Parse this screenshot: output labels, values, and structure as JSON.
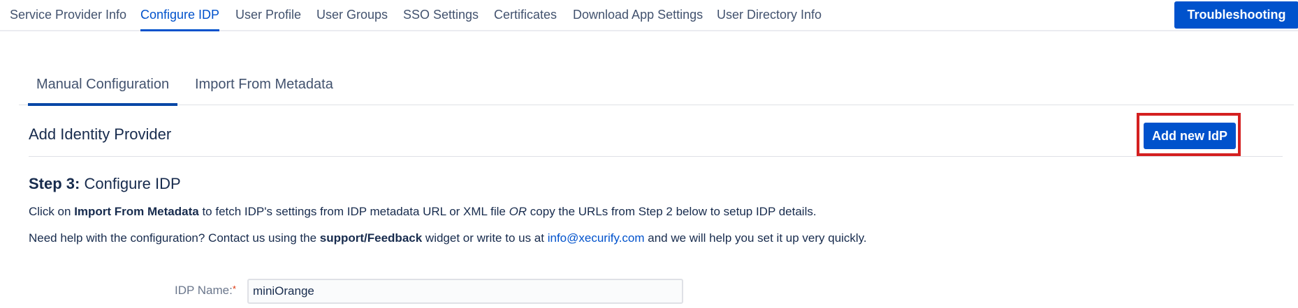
{
  "nav": {
    "items": [
      {
        "label": "Service Provider Info"
      },
      {
        "label": "Configure IDP"
      },
      {
        "label": "User Profile"
      },
      {
        "label": "User Groups"
      },
      {
        "label": "SSO Settings"
      },
      {
        "label": "Certificates"
      },
      {
        "label": "Download App Settings"
      },
      {
        "label": "User Directory Info"
      }
    ],
    "active": "Configure IDP",
    "troubleshoot_label": "Troubleshooting"
  },
  "subtabs": {
    "manual": "Manual Configuration",
    "import": "Import From Metadata",
    "active": "Manual Configuration"
  },
  "header": {
    "title": "Add Identity Provider",
    "add_button": "Add new IdP"
  },
  "step": {
    "number": "Step 3:",
    "title": "Configure IDP"
  },
  "para1": {
    "t1": "Click on ",
    "bold": "Import From Metadata",
    "t2": " to fetch IDP's settings from IDP metadata URL or XML file ",
    "italic": "OR",
    "t3": " copy the URLs from Step 2 below to setup IDP details."
  },
  "para2": {
    "t1": "Need help with the configuration? Contact us using the ",
    "bold": "support/Feedback",
    "t2": " widget or write to us at ",
    "link": "info@xecurify.com",
    "t3": " and we will help you set it up very quickly."
  },
  "form": {
    "idp_name_label": "IDP Name:",
    "required_mark": "*",
    "idp_name_value": "miniOrange"
  },
  "colors": {
    "accent": "#0052cc",
    "highlight": "#d42020"
  }
}
